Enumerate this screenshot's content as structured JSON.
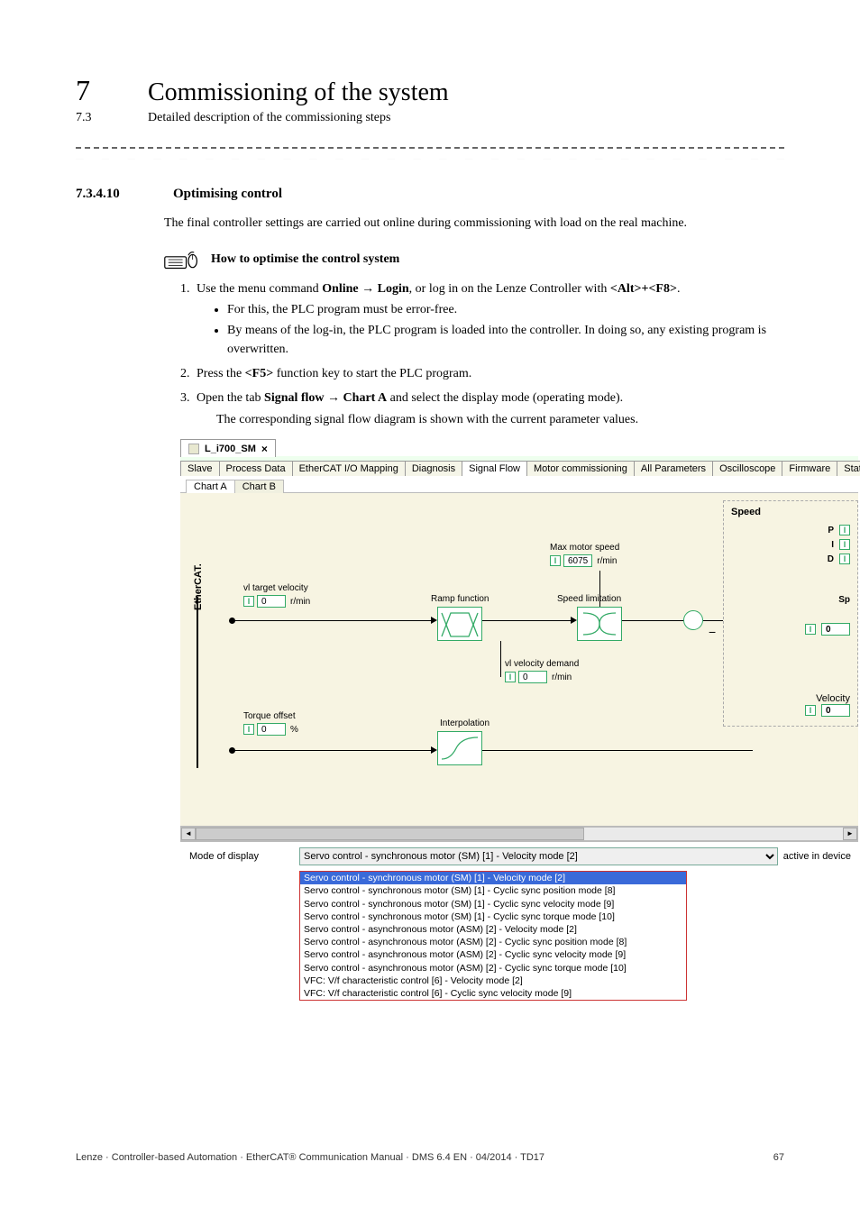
{
  "header": {
    "chapter_num": "7",
    "chapter_title": "Commissioning of the system",
    "section_num": "7.3",
    "section_title": "Detailed description of the commissioning steps"
  },
  "section": {
    "num": "7.3.4.10",
    "title": "Optimising control",
    "intro": "The final controller settings are carried out online during commissioning with load on the real machine.",
    "howto_title": "How to optimise the control system",
    "step1_pre": "Use the menu command ",
    "step1_bold1": "Online → Login",
    "step1_mid": ", or log in on the Lenze Controller with ",
    "step1_bold2": "<Alt>+<F8>",
    "step1_post": ".",
    "step1_b1": "For this, the PLC program must be error-free.",
    "step1_b2": "By means of the log-in, the PLC program is loaded into the controller. In doing so, any existing program is overwritten.",
    "step2_pre": "Press the ",
    "step2_bold": "<F5>",
    "step2_post": " function key to start the PLC program.",
    "step3_pre": "Open the tab ",
    "step3_bold": "Signal flow → Chart A",
    "step3_post": " and select the display mode (operating mode).",
    "step3_after": "The corresponding signal flow diagram is shown with the current parameter values."
  },
  "screenshot": {
    "tab_title": "L_i700_SM",
    "close": "×",
    "tabs": [
      "Slave",
      "Process Data",
      "EtherCAT I/O Mapping",
      "Diagnosis",
      "Signal Flow",
      "Motor commissioning",
      "All Parameters",
      "Oscilloscope",
      "Firmware",
      "Stat"
    ],
    "active_tab_index": 4,
    "chart_tabs": [
      "Chart A",
      "Chart B"
    ],
    "active_chart_index": 0,
    "ecat": "EtherCAT.",
    "vl_target": {
      "label": "vl target velocity",
      "value": "0",
      "unit": "r/min"
    },
    "torque_offset": {
      "label": "Torque offset",
      "value": "0",
      "unit": "%"
    },
    "ramp": "Ramp function",
    "interp": "Interpolation",
    "max_speed": {
      "label": "Max motor speed",
      "value": "6075",
      "unit": "r/min"
    },
    "speed_lim": "Speed limitation",
    "vl_demand": {
      "label": "vl velocity demand",
      "value": "0",
      "unit": "r/min"
    },
    "speed_panel": {
      "title": "Speed",
      "P": "P",
      "I": "I",
      "D": "D",
      "Sp": "Sp",
      "vel_label": "Velocity",
      "vel_value": "0",
      "low_value": "0"
    },
    "mode_label": "Mode of display",
    "mode_selected": "Servo control - synchronous motor (SM) [1] - Velocity mode [2]",
    "active_in_device": "active in device",
    "dropdown": [
      "Servo control - synchronous motor (SM) [1] - Velocity mode [2]",
      "Servo control - synchronous motor (SM) [1] - Cyclic sync position mode [8]",
      "Servo control - synchronous motor (SM) [1] - Cyclic sync velocity mode [9]",
      "Servo control - synchronous motor (SM) [1] - Cyclic sync torque mode [10]",
      "Servo control - asynchronous motor (ASM) [2] - Velocity mode [2]",
      "Servo control - asynchronous motor (ASM) [2] - Cyclic sync position mode [8]",
      "Servo control - asynchronous motor (ASM) [2] - Cyclic sync velocity mode [9]",
      "Servo control - asynchronous motor (ASM) [2] - Cyclic sync torque mode [10]",
      "VFC: V/f characteristic control [6] - Velocity mode [2]",
      "VFC: V/f characteristic control [6] - Cyclic sync velocity mode [9]"
    ]
  },
  "footer": {
    "left": "Lenze · Controller-based Automation · EtherCAT® Communication Manual · DMS 6.4 EN · 04/2014 · TD17",
    "right": "67"
  }
}
